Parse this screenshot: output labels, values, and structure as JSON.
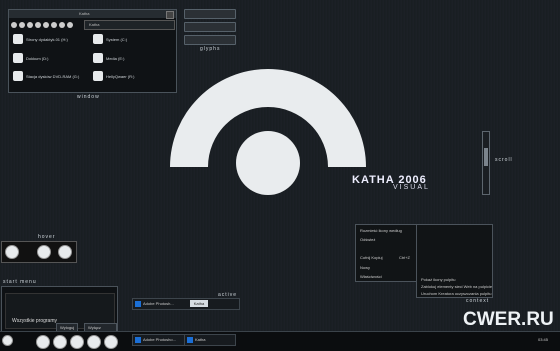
{
  "window": {
    "title": "Katha",
    "address": "Katha",
    "caption": "window",
    "drives": [
      {
        "label": "Strony dydaktyk.01 (H:)"
      },
      {
        "label": "System (C:)"
      },
      {
        "label": "Dokkum (D:)"
      },
      {
        "label": "Media (E:)"
      },
      {
        "label": "Stacja dysków DVD-RAM (G:)"
      },
      {
        "label": "HellyQwaer (R:)"
      }
    ]
  },
  "glyphs": {
    "caption": "glyphs"
  },
  "theme": {
    "name": "KATHA 2006",
    "sub": "VISUAL"
  },
  "scroll": {
    "caption": "scroll"
  },
  "hover": {
    "caption": "hover"
  },
  "start_menu": {
    "caption": "start menu",
    "all_programs": "Wszystkie programy",
    "logoff": "Wyloguj",
    "shutdown": "Wyłącz komputer"
  },
  "active": {
    "caption": "active",
    "task": "Adobe Photosh...",
    "badge": "Katha"
  },
  "context": {
    "caption": "context",
    "items": [
      "Rozmieść ikony według",
      "Odśwież",
      "Cofnij Kopiuj",
      "Nowy",
      "Właściwości"
    ],
    "undo_shortcut": "Ctrl+Z",
    "sub_items": [
      "Pokaż ikony pulpitu",
      "Zablokuj elementy sieci Web na pulpicie",
      "Uruchom Kreatora oczyszczania pulpitu"
    ]
  },
  "taskbar": {
    "tasks": [
      "Adobe Photosho...",
      "Katha"
    ],
    "clock": "03:45"
  },
  "watermark": "CWER.RU",
  "colors": {
    "accent": "#1b6fd6",
    "arc": "#e9ecee",
    "bg": "#1a1e22"
  }
}
